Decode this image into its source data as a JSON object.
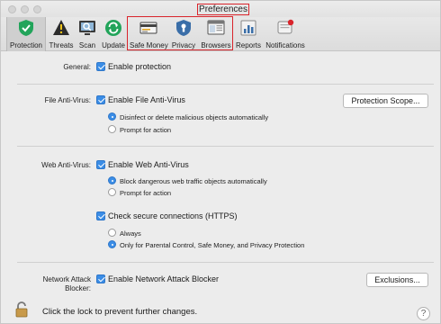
{
  "window": {
    "title": "Preferences"
  },
  "toolbar": {
    "items": [
      {
        "label": "Protection",
        "icon": "shield-check-icon"
      },
      {
        "label": "Threats",
        "icon": "warning-icon"
      },
      {
        "label": "Scan",
        "icon": "scan-monitor-icon"
      },
      {
        "label": "Update",
        "icon": "update-arrows-icon"
      },
      {
        "label": "Safe Money",
        "icon": "credit-card-icon"
      },
      {
        "label": "Privacy",
        "icon": "privacy-shield-icon"
      },
      {
        "label": "Browsers",
        "icon": "browser-window-icon"
      },
      {
        "label": "Reports",
        "icon": "reports-icon"
      },
      {
        "label": "Notifications",
        "icon": "notification-bell-icon"
      }
    ]
  },
  "general": {
    "label": "General:",
    "enable_protection": "Enable protection"
  },
  "file_av": {
    "label": "File Anti-Virus:",
    "enable": "Enable File Anti-Virus",
    "scope_button": "Protection Scope...",
    "option_disinfect": "Disinfect or delete malicious objects automatically",
    "option_prompt": "Prompt for action"
  },
  "web_av": {
    "label": "Web Anti-Virus:",
    "enable": "Enable Web Anti-Virus",
    "option_block": "Block dangerous web traffic objects automatically",
    "option_prompt": "Prompt for action",
    "https_check": "Check secure connections (HTTPS)",
    "https_always": "Always",
    "https_only": "Only for Parental Control, Safe Money, and Privacy Protection"
  },
  "network": {
    "label_line1": "Network Attack",
    "label_line2": "Blocker:",
    "enable": "Enable Network Attack Blocker",
    "exclusions_button": "Exclusions..."
  },
  "footer": {
    "lock_text": "Click the lock to prevent further changes.",
    "help": "?"
  },
  "colors": {
    "accent": "#3b8de6",
    "highlight_box": "#d9242b",
    "protection_green": "#22a45a"
  }
}
